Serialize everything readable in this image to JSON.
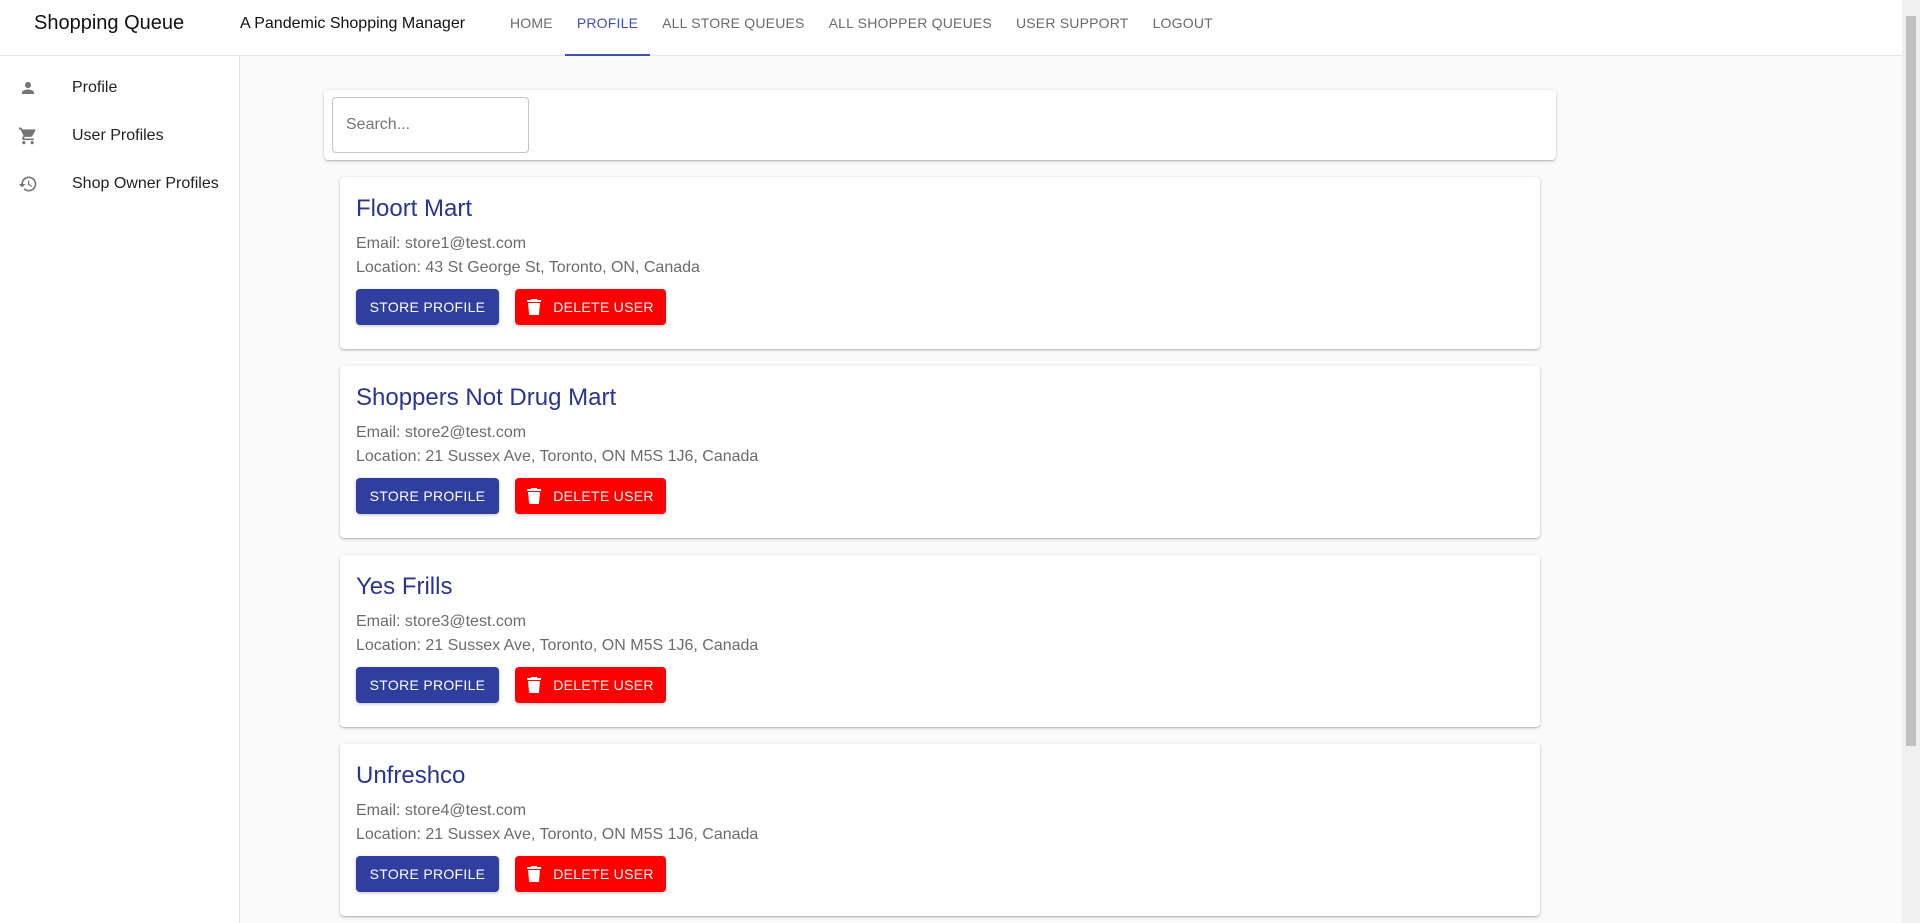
{
  "app": {
    "brand": "Shopping Queue",
    "tagline": "A Pandemic Shopping Manager"
  },
  "nav": {
    "items": [
      {
        "label": "HOME",
        "active": false
      },
      {
        "label": "PROFILE",
        "active": true
      },
      {
        "label": "ALL STORE QUEUES",
        "active": false
      },
      {
        "label": "ALL SHOPPER QUEUES",
        "active": false
      },
      {
        "label": "USER SUPPORT",
        "active": false
      },
      {
        "label": "LOGOUT",
        "active": false
      }
    ]
  },
  "sidebar": {
    "items": [
      {
        "label": "Profile",
        "icon": "person-icon"
      },
      {
        "label": "User Profiles",
        "icon": "shopping-cart-icon"
      },
      {
        "label": "Shop Owner Profiles",
        "icon": "history-icon"
      }
    ]
  },
  "search": {
    "placeholder": "Search...",
    "value": ""
  },
  "stores": [
    {
      "name": "Floort Mart",
      "email": "Email: store1@test.com",
      "location": "Location: 43 St George St, Toronto, ON, Canada"
    },
    {
      "name": "Shoppers Not Drug Mart",
      "email": "Email: store2@test.com",
      "location": "Location: 21 Sussex Ave, Toronto, ON M5S 1J6, Canada"
    },
    {
      "name": "Yes Frills",
      "email": "Email: store3@test.com",
      "location": "Location: 21 Sussex Ave, Toronto, ON M5S 1J6, Canada"
    },
    {
      "name": "Unfreshco",
      "email": "Email: store4@test.com",
      "location": "Location: 21 Sussex Ave, Toronto, ON M5S 1J6, Canada"
    }
  ],
  "buttons": {
    "store_profile": "STORE PROFILE",
    "delete_user": "DELETE USER"
  },
  "colors": {
    "primary": "#3f51b5",
    "primary_button": "#303f9f",
    "danger": "#ff0000",
    "title": "#283593"
  }
}
